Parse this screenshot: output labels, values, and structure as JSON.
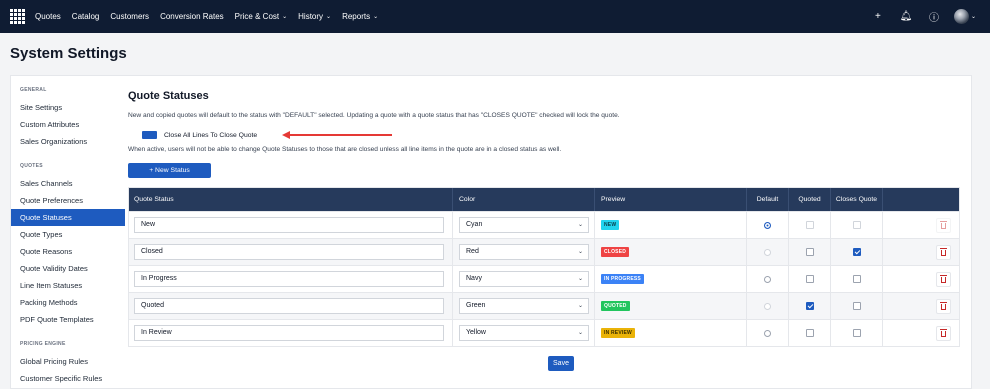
{
  "topnav": {
    "items": [
      {
        "label": "Quotes",
        "dropdown": false
      },
      {
        "label": "Catalog",
        "dropdown": false
      },
      {
        "label": "Customers",
        "dropdown": false
      },
      {
        "label": "Conversion Rates",
        "dropdown": false
      },
      {
        "label": "Price & Cost",
        "dropdown": true
      },
      {
        "label": "History",
        "dropdown": true
      },
      {
        "label": "Reports",
        "dropdown": true
      }
    ],
    "right_icons": [
      "plus-icon",
      "bell-icon",
      "help-icon"
    ]
  },
  "page": {
    "title": "System Settings"
  },
  "sidebar": {
    "sections": [
      {
        "heading": "GENERAL",
        "items": [
          "Site Settings",
          "Custom Attributes",
          "Sales Organizations"
        ]
      },
      {
        "heading": "QUOTES",
        "items": [
          "Sales Channels",
          "Quote Preferences",
          "Quote Statuses",
          "Quote Types",
          "Quote Reasons",
          "Quote Validity Dates",
          "Line Item Statuses",
          "Packing Methods",
          "PDF Quote Templates"
        ]
      },
      {
        "heading": "PRICING ENGINE",
        "items": [
          "Global Pricing Rules",
          "Customer Specific Rules"
        ]
      }
    ],
    "active_item": "Quote Statuses"
  },
  "main": {
    "title": "Quote Statuses",
    "description": "New and copied quotes will default to the status with \"DEFAULT\" selected. Updating a quote with a quote status that has \"CLOSES QUOTE\" checked will lock the quote.",
    "toggle_label": "Close All Lines To Close Quote",
    "toggle_on": true,
    "note": "When active, users will not be able to change Quote Statuses to those that are closed unless all line items in the quote are in a closed status as well.",
    "new_button": "+ New Status",
    "save_button": "Save"
  },
  "table": {
    "headers": {
      "status": "Quote Status",
      "color": "Color",
      "preview": "Preview",
      "default": "Default",
      "quoted": "Quoted",
      "closes": "Closes Quote"
    },
    "rows": [
      {
        "name": "New",
        "color": "Cyan",
        "badge": "NEW",
        "badge_bg": "#22d3ee",
        "badge_fg": "#0b3d4a",
        "default": true,
        "quoted": false,
        "closes": false,
        "disabled": true
      },
      {
        "name": "Closed",
        "color": "Red",
        "badge": "CLOSED",
        "badge_bg": "#ef4444",
        "badge_fg": "#ffffff",
        "default": false,
        "quoted": false,
        "closes": true,
        "disabled": false
      },
      {
        "name": "In Progress",
        "color": "Navy",
        "badge": "IN PROGRESS",
        "badge_bg": "#3b82f6",
        "badge_fg": "#ffffff",
        "default": false,
        "quoted": false,
        "closes": false,
        "disabled": false
      },
      {
        "name": "Quoted",
        "color": "Green",
        "badge": "QUOTED",
        "badge_bg": "#22c55e",
        "badge_fg": "#ffffff",
        "default": false,
        "quoted": true,
        "closes": false,
        "disabled": false
      },
      {
        "name": "In Review",
        "color": "Yellow",
        "badge": "IN REVIEW",
        "badge_bg": "#eab308",
        "badge_fg": "#3b2f00",
        "default": false,
        "quoted": false,
        "closes": false,
        "disabled": false
      }
    ]
  },
  "colors": {
    "nav_bg": "#0f1c33",
    "accent": "#1e5bbf",
    "table_header": "#263a5c",
    "annotation_arrow": "#e53935"
  }
}
